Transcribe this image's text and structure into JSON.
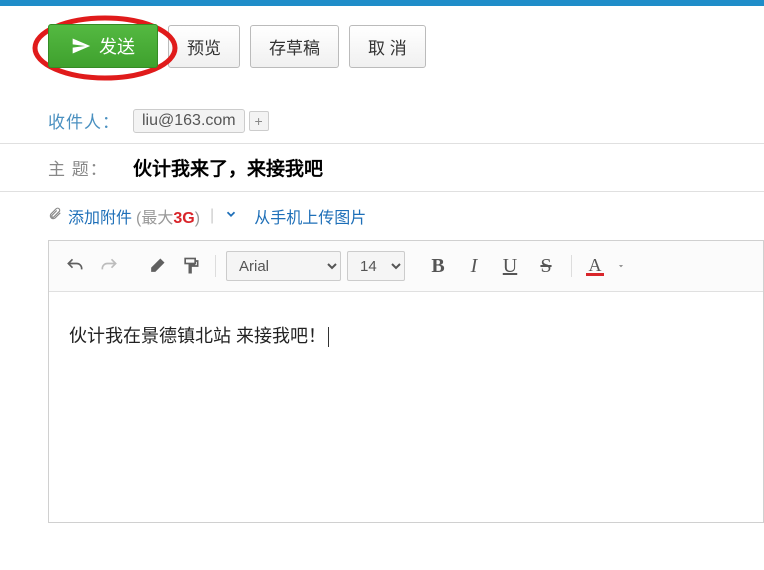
{
  "toolbar": {
    "send": "发送",
    "preview": "预览",
    "draft": "存草稿",
    "cancel": "取 消"
  },
  "recipient": {
    "label": "收件人：",
    "email": "liu@163.com"
  },
  "subject": {
    "label": "主 题：",
    "value": "伙计我来了，来接我吧"
  },
  "attach": {
    "add": "添加附件",
    "max_prefix": "(最大",
    "max_size": "3G",
    "max_suffix": ")",
    "phone": "从手机上传图片"
  },
  "editor_toolbar": {
    "font": "Arial",
    "size": "14",
    "bold": "B",
    "italic": "I",
    "underline": "U",
    "strike": "S",
    "color": "A"
  },
  "body": "伙计我在景德镇北站 来接我吧！"
}
